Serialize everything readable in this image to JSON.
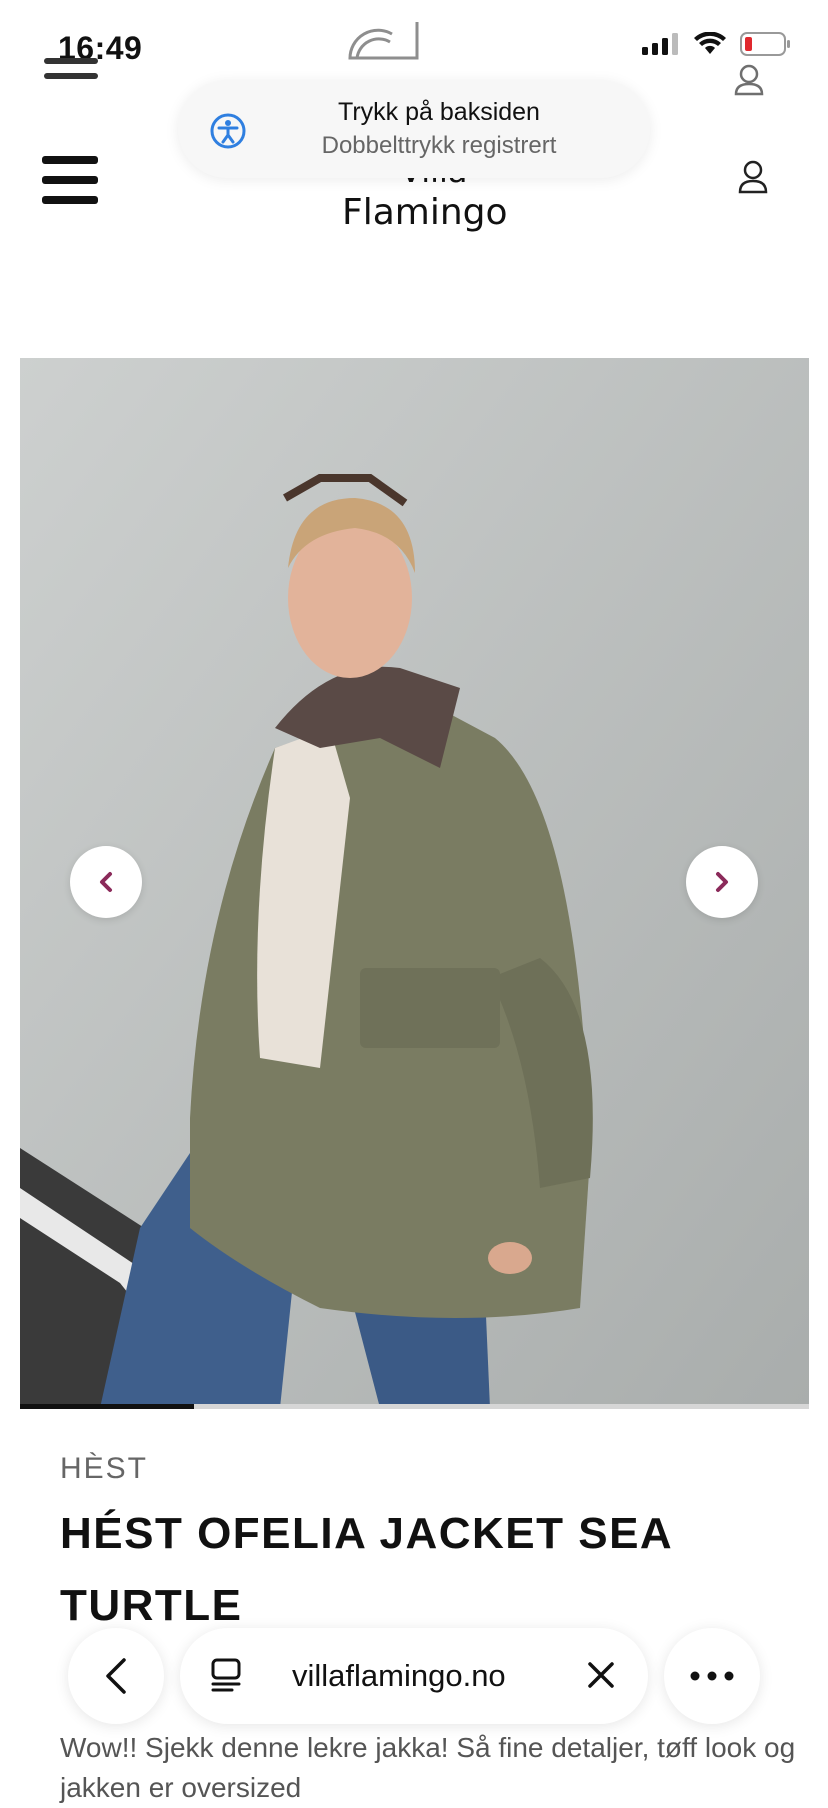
{
  "status_bar": {
    "time": "16:49"
  },
  "toast": {
    "title": "Trykk på baksiden",
    "subtitle": "Dobbelttrykk registrert"
  },
  "header": {
    "logo_line1": "Villa",
    "logo_line2": "Flamingo"
  },
  "gallery": {
    "progress_fraction": 0.22
  },
  "product": {
    "brand": "HÈST",
    "title": "HÉST OFELIA JACKET SEA TURTLE",
    "description": "Wow!! Sjekk denne lekre jakka! Så fine detaljer, tøff look og jakken er oversized"
  },
  "browser_bar": {
    "url": "villaflamingo.no"
  },
  "colors": {
    "arrow_accent": "#8b2a5a",
    "toast_icon": "#2f7fe0"
  }
}
